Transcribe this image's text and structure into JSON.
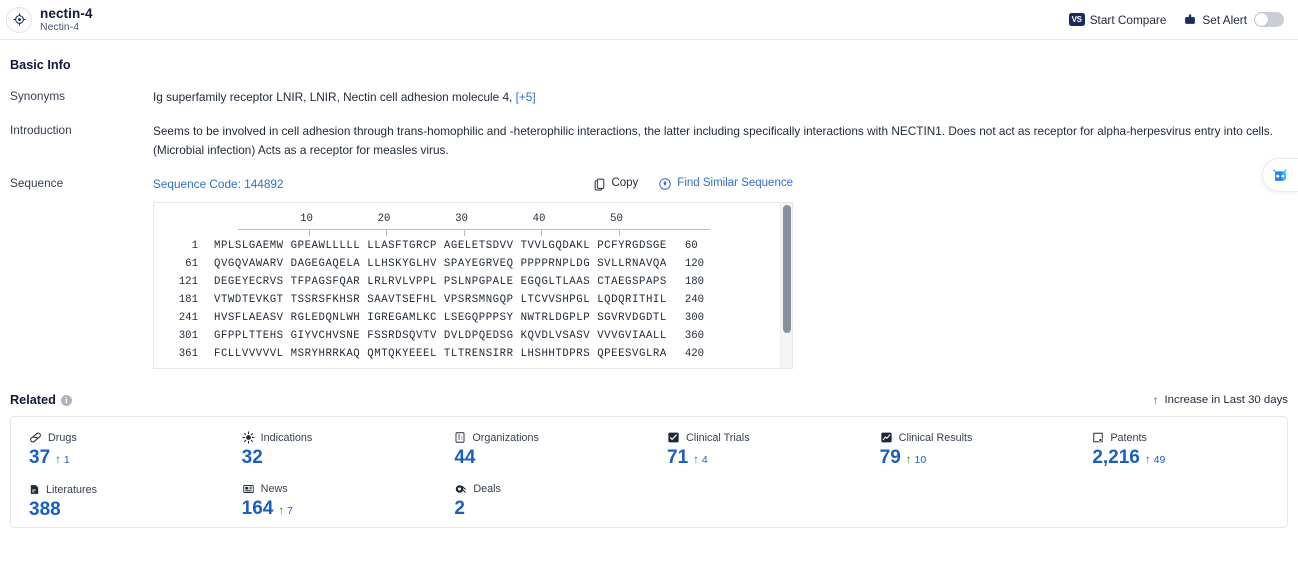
{
  "header": {
    "icon": "target-icon",
    "title": "nectin-4",
    "subtitle": "Nectin-4",
    "start_compare_label": "Start Compare",
    "start_compare_badge": "VS",
    "set_alert_label": "Set Alert",
    "alert_toggle_state": "off"
  },
  "basic_info": {
    "section_title": "Basic Info",
    "synonyms_label": "Synonyms",
    "synonyms_value": "Ig superfamily receptor LNIR,  LNIR,  Nectin cell adhesion molecule 4,",
    "synonyms_more": "[+5]",
    "introduction_label": "Introduction",
    "introduction_value": "Seems to be involved in cell adhesion through trans-homophilic and -heterophilic interactions, the latter including specifically interactions with NECTIN1. Does not act as receptor for alpha-herpesvirus entry into cells. (Microbial infection) Acts as a receptor for measles virus."
  },
  "sequence": {
    "label": "Sequence",
    "code_label": "Sequence Code: 144892",
    "copy_label": "Copy",
    "find_similar_label": "Find Similar Sequence",
    "ruler_ticks": [
      10,
      20,
      30,
      40,
      50
    ],
    "rows": [
      {
        "start": "1",
        "chunks": [
          "MPLSLGAEMW",
          "GPEAWLLLLL",
          "LLASFTGRCP",
          "AGELETSDVV",
          "TVVLGQDAKL",
          "PCFYRGDSGE"
        ],
        "end": "60"
      },
      {
        "start": "61",
        "chunks": [
          "QVGQVAWARV",
          "DAGEGAQELA",
          "LLHSKYGLHV",
          "SPAYEGRVEQ",
          "PPPPRNPLDG",
          "SVLLRNAVQA"
        ],
        "end": "120"
      },
      {
        "start": "121",
        "chunks": [
          "DEGEYECRVS",
          "TFPAGSFQAR",
          "LRLRVLVPPL",
          "PSLNPGPALE",
          "EGQGLTLAAS",
          "CTAEGSPAPS"
        ],
        "end": "180"
      },
      {
        "start": "181",
        "chunks": [
          "VTWDTEVKGT",
          "TSSRSFKHSR",
          "SAAVTSEFHL",
          "VPSRSMNGQP",
          "LTCVVSHPGL",
          "LQDQRITHIL"
        ],
        "end": "240"
      },
      {
        "start": "241",
        "chunks": [
          "HVSFLAEASV",
          "RGLEDQNLWH",
          "IGREGAMLKC",
          "LSEGQPPPSY",
          "NWTRLDGPLP",
          "SGVRVDGDTL"
        ],
        "end": "300"
      },
      {
        "start": "301",
        "chunks": [
          "GFPPLTTEHS",
          "GIYVCHVSNE",
          "FSSRDSQVTV",
          "DVLDPQEDSG",
          "KQVDLVSASV",
          "VVVGVIAALL"
        ],
        "end": "360"
      },
      {
        "start": "361",
        "chunks": [
          "FCLLVVVVVL",
          "MSRYHRRKAQ",
          "QMTQKYEEEL",
          "TLTRENSIRR",
          "LHSHHTDPRS",
          "QPEESVGLRA"
        ],
        "end": "420"
      }
    ]
  },
  "related": {
    "title": "Related",
    "info_glyph": "i",
    "legend_label": "Increase in Last 30 days",
    "stats": [
      {
        "icon": "pill-icon",
        "label": "Drugs",
        "value": "37",
        "delta": "1"
      },
      {
        "icon": "virus-icon",
        "label": "Indications",
        "value": "32",
        "delta": ""
      },
      {
        "icon": "building-icon",
        "label": "Organizations",
        "value": "44",
        "delta": ""
      },
      {
        "icon": "clinical-trial-icon",
        "label": "Clinical Trials",
        "value": "71",
        "delta": "4"
      },
      {
        "icon": "clinical-result-icon",
        "label": "Clinical Results",
        "value": "79",
        "delta": "10"
      },
      {
        "icon": "patent-icon",
        "label": "Patents",
        "value": "2,216",
        "delta": "49"
      },
      {
        "icon": "literature-icon",
        "label": "Literatures",
        "value": "388",
        "delta": ""
      },
      {
        "icon": "news-icon",
        "label": "News",
        "value": "164",
        "delta": "7"
      },
      {
        "icon": "deal-icon",
        "label": "Deals",
        "value": "2",
        "delta": ""
      }
    ]
  },
  "assistant": {
    "icon": "bot-icon"
  },
  "colors": {
    "accent_blue": "#1a5fbf",
    "link_blue": "#2f6fd0",
    "increase_green": "#27892f",
    "dark_navy": "#11193a"
  }
}
